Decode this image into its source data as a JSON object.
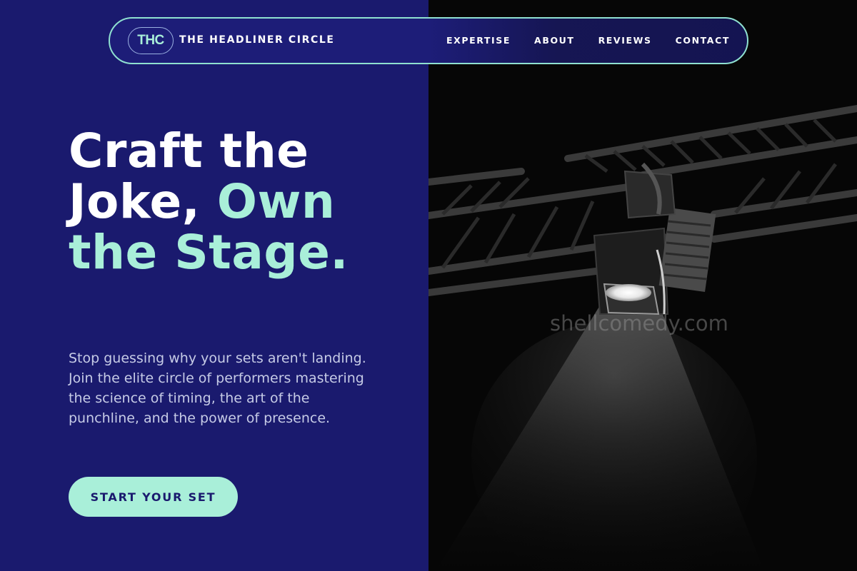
{
  "nav": {
    "logo_text": "THC",
    "brand_name": "THE HEADLINER CIRCLE",
    "links": [
      "EXPERTISE",
      "ABOUT",
      "REVIEWS",
      "CONTACT"
    ]
  },
  "hero": {
    "title_white": "Craft the Joke, ",
    "title_accent": "Own the Stage.",
    "description": "Stop guessing why your sets aren't landing. Join the elite circle of performers mastering the science of timing, the art of the punchline, and the power of presence.",
    "cta_label": "START YOUR SET"
  },
  "image": {
    "watermark": "shellcomedy.com",
    "subject": "stage spotlight on lighting truss"
  },
  "colors": {
    "primary_navy": "#1a1a6e",
    "accent_mint": "#a9efd9",
    "white": "#ffffff",
    "body_text": "#c6cbe6"
  }
}
